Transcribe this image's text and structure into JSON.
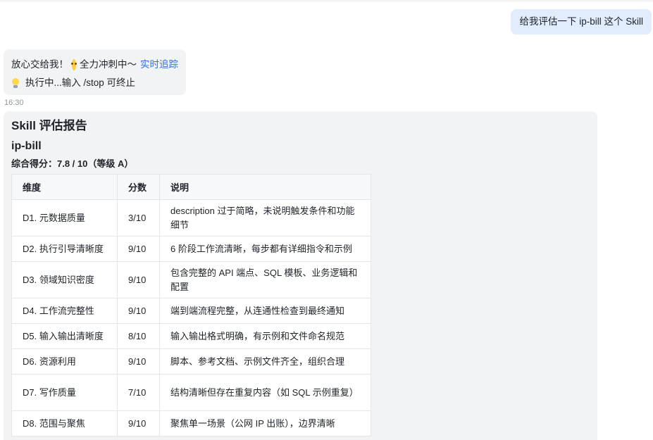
{
  "user_message": "给我评估一下 ip-bill 这个 Skill",
  "bot_status": {
    "line1_text": "放心交给我！",
    "line1_suffix": "全力冲刺中～",
    "link_text": "实时追踪",
    "line2_text": "执行中...输入 /stop 可终止"
  },
  "timestamp": "16:30",
  "report": {
    "title": "Skill 评估报告",
    "skill_name": "ip-bill",
    "overall": "综合得分：7.8 / 10（等级 A）",
    "headers": [
      "维度",
      "分数",
      "说明"
    ],
    "rows": [
      {
        "dim": "D1. 元数据质量",
        "score": "3/10",
        "desc": "description 过于简略，未说明触发条件和功能细节"
      },
      {
        "dim": "D2. 执行引导清晰度",
        "score": "9/10",
        "desc": "6 阶段工作流清晰，每步都有详细指令和示例"
      },
      {
        "dim": "D3. 领域知识密度",
        "score": "9/10",
        "desc": "包含完整的 API 端点、SQL 模板、业务逻辑和配置"
      },
      {
        "dim": "D4. 工作流完整性",
        "score": "9/10",
        "desc": "端到端流程完整，从连通性检查到最终通知"
      },
      {
        "dim": "D5. 输入输出清晰度",
        "score": "8/10",
        "desc": "输入输出格式明确，有示例和文件命名规范"
      },
      {
        "dim": "D6. 资源利用",
        "score": "9/10",
        "desc": "脚本、参考文档、示例文件齐全，组织合理"
      },
      {
        "dim": "D7. 写作质量",
        "score": "7/10",
        "desc": "结构清晰但存在重复内容（如 SQL 示例重复）"
      },
      {
        "dim": "D8. 范围与聚焦",
        "score": "9/10",
        "desc": "聚焦单一场景（公网 IP 出账），边界清晰"
      }
    ]
  },
  "icons": {
    "emoji": "determined-face-emoji-icon",
    "bulb": "light-bulb-icon"
  },
  "colors": {
    "user_bubble": "#e1ecfd",
    "bot_bubble": "#f2f3f5",
    "link": "#2f6fde"
  }
}
